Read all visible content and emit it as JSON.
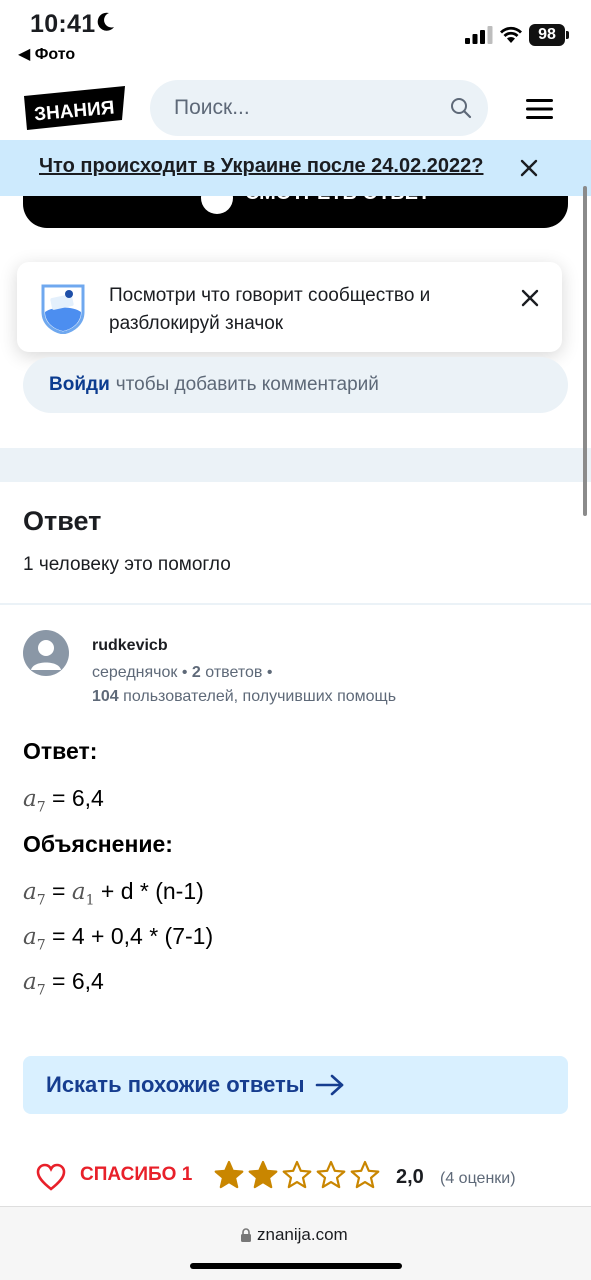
{
  "status_bar": {
    "time": "10:41",
    "back_label": "◀ Фото",
    "battery": "98"
  },
  "header": {
    "logo_text": "ЗНАНИЯ",
    "search_placeholder": "Поиск..."
  },
  "banner": {
    "text": "Что происходит в Украине после 24.02.2022?"
  },
  "see_answer_button": {
    "label": "СМОТРЕТЬ ОТВЕТ"
  },
  "tooltip": {
    "text": "Посмотри что говорит сообщество и разблокируй значок"
  },
  "comment": {
    "login_link": "Войди",
    "placeholder": "чтобы добавить комментарий"
  },
  "answer_section": {
    "heading": "Ответ",
    "helped": "1 человеку это помогло",
    "user": {
      "name": "rudkevicb",
      "rank": "середнячок",
      "answers_count": "2",
      "answers_label": "ответов",
      "helped_count": "104",
      "helped_label": "пользователей, получивших помощь"
    },
    "body": {
      "answer_label": "Ответ:",
      "line1_var": "a",
      "line1_sub": "7",
      "line1_rest": " = 6,4",
      "explanation_label": "Объяснение:",
      "line2_var": "a",
      "line2_sub": "7",
      "line2_mid": " = ",
      "line2_var2": "a",
      "line2_sub2": "1",
      "line2_rest": " + d * (n-1)",
      "line3_var": "a",
      "line3_sub": "7",
      "line3_rest": " = 4 + 0,4 * (7-1)",
      "line4_var": "a",
      "line4_sub": "7",
      "line4_rest": " = 6,4"
    }
  },
  "similar_button": {
    "label": "Искать похожие ответы"
  },
  "feedback": {
    "thanks_label": "СПАСИБО",
    "thanks_count": "1",
    "rating_value": "2,0",
    "rating_count": "(4 оценки)",
    "stars_filled": 2,
    "stars_total": 5,
    "star_color": "#c98600"
  },
  "browser": {
    "url": "znanija.com"
  }
}
